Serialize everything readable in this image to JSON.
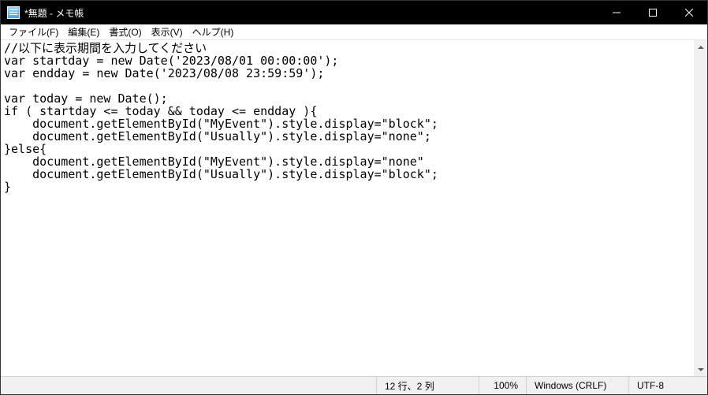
{
  "titlebar": {
    "title": "*無題 - メモ帳"
  },
  "menu": {
    "file": "ファイル(F)",
    "edit": "編集(E)",
    "format": "書式(O)",
    "view": "表示(V)",
    "help": "ヘルプ(H)"
  },
  "editor": {
    "content": "//以下に表示期間を入力してください\nvar startday = new Date('2023/08/01 00:00:00');\nvar endday = new Date('2023/08/08 23:59:59');\n\nvar today = new Date();\nif ( startday <= today && today <= endday ){\n    document.getElementById(\"MyEvent\").style.display=\"block\";\n    document.getElementById(\"Usually\").style.display=\"none\";\n}else{\n    document.getElementById(\"MyEvent\").style.display=\"none\"\n    document.getElementById(\"Usually\").style.display=\"block\";\n}"
  },
  "status": {
    "position": "12 行、2 列",
    "zoom": "100%",
    "eol": "Windows (CRLF)",
    "encoding": "UTF-8"
  }
}
